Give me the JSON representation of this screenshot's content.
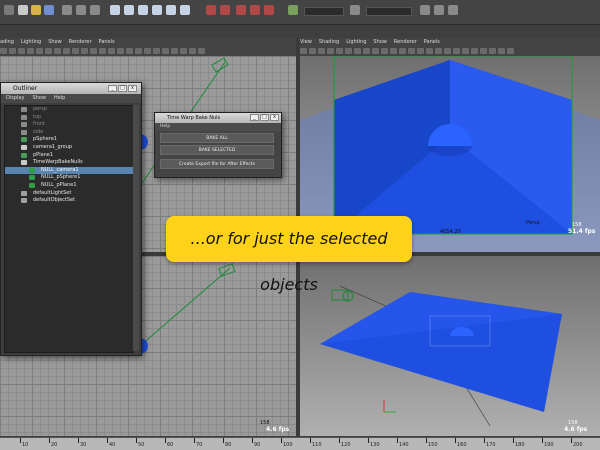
{
  "toolbar": {
    "field_left": "",
    "field_mid": "",
    "right_label": ""
  },
  "panels": {
    "menu": [
      "View",
      "Shading",
      "Lighting",
      "Show",
      "Renderer",
      "Panels"
    ],
    "top_left_menu": [
      "ading",
      "Lighting",
      "Show",
      "Renderer",
      "Panels"
    ],
    "fps_main": "4.6 fps",
    "fps_bottom_left": "4.6 fps",
    "fps_top_right": "51.4 fps",
    "fps_bottom_right": "4.6 fps",
    "hud_num_tl": "158",
    "hud_num_tr": "158",
    "hud_num_br": "158",
    "hud_num_bl": "158",
    "persp_label": "Persp",
    "persp_frame": "4054.20"
  },
  "outliner": {
    "title": "Outliner",
    "menu": [
      "Display",
      "Show",
      "Help"
    ],
    "items": [
      {
        "label": "persp",
        "dim": true,
        "selected": false,
        "indent": 0,
        "icon": "camera-icon"
      },
      {
        "label": "top",
        "dim": true,
        "selected": false,
        "indent": 0,
        "icon": "camera-icon"
      },
      {
        "label": "front",
        "dim": true,
        "selected": false,
        "indent": 0,
        "icon": "camera-icon"
      },
      {
        "label": "side",
        "dim": true,
        "selected": false,
        "indent": 0,
        "icon": "camera-icon"
      },
      {
        "label": "pSphere1",
        "dim": false,
        "selected": false,
        "indent": 0,
        "icon": "mesh-icon"
      },
      {
        "label": "camera1_group",
        "dim": false,
        "selected": false,
        "indent": 0,
        "icon": "group-icon"
      },
      {
        "label": "pPlane1",
        "dim": false,
        "selected": false,
        "indent": 0,
        "icon": "mesh-icon"
      },
      {
        "label": "TimeWarpBakeNulls",
        "dim": false,
        "selected": false,
        "indent": 0,
        "icon": "group-icon"
      },
      {
        "label": "NULL_camera1",
        "dim": false,
        "selected": true,
        "indent": 1,
        "icon": "null-icon"
      },
      {
        "label": "NULL_pSphere1",
        "dim": false,
        "selected": false,
        "indent": 1,
        "icon": "null-icon"
      },
      {
        "label": "NULL_pPlane1",
        "dim": false,
        "selected": false,
        "indent": 1,
        "icon": "null-icon"
      },
      {
        "label": "defaultLightSet",
        "dim": false,
        "selected": false,
        "indent": 0,
        "icon": "set-icon"
      },
      {
        "label": "defaultObjectSet",
        "dim": false,
        "selected": false,
        "indent": 0,
        "icon": "set-icon"
      }
    ]
  },
  "timewarp": {
    "title": "Time Warp Bake Nuls",
    "menu": "Help",
    "bake_all": "BAKE ALL",
    "bake_selected": "BAKE SELECTED",
    "create_export": "Create Export file for After Effects"
  },
  "callout": {
    "text": "...or for just the selected objects"
  },
  "timeline": {
    "labels": [
      "10",
      "20",
      "30",
      "40",
      "50",
      "60",
      "70",
      "80",
      "90",
      "100",
      "110",
      "120",
      "130",
      "140",
      "150",
      "160",
      "170",
      "180",
      "190",
      "200"
    ]
  },
  "colors": {
    "accent_blue": "#1f4fe0",
    "callout_yellow": "#ffd21a",
    "selection_blue": "#5a84b0",
    "camera_green": "#1b8a3a"
  }
}
